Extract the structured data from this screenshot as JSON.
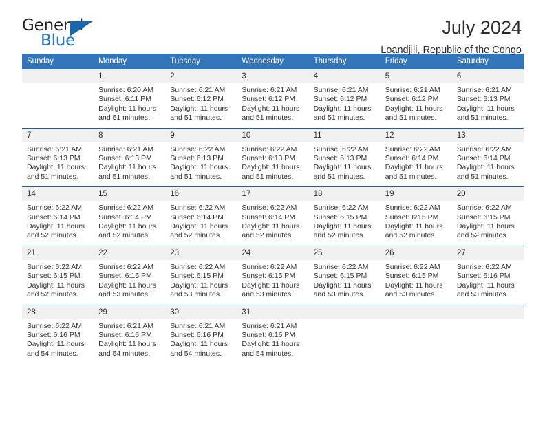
{
  "brand": {
    "name_top": "General",
    "name_bottom": "Blue",
    "accent_color": "#2176bd",
    "triangle_color": "#1866ab",
    "text_color": "#232323"
  },
  "header": {
    "title": "July 2024",
    "subtitle": "Loandjili, Republic of the Congo"
  },
  "theme": {
    "header_blue": "#3275b9",
    "row_divider": "#1f5f9e",
    "daynum_band": "#f0f0f0"
  },
  "calendar": {
    "weekdays": [
      "Sunday",
      "Monday",
      "Tuesday",
      "Wednesday",
      "Thursday",
      "Friday",
      "Saturday"
    ],
    "weeks": [
      [
        {
          "day": "",
          "sunrise": "",
          "sunset": "",
          "daylight_line1": "",
          "daylight_line2": ""
        },
        {
          "day": "1",
          "sunrise": "Sunrise: 6:20 AM",
          "sunset": "Sunset: 6:11 PM",
          "daylight_line1": "Daylight: 11 hours",
          "daylight_line2": "and 51 minutes."
        },
        {
          "day": "2",
          "sunrise": "Sunrise: 6:21 AM",
          "sunset": "Sunset: 6:12 PM",
          "daylight_line1": "Daylight: 11 hours",
          "daylight_line2": "and 51 minutes."
        },
        {
          "day": "3",
          "sunrise": "Sunrise: 6:21 AM",
          "sunset": "Sunset: 6:12 PM",
          "daylight_line1": "Daylight: 11 hours",
          "daylight_line2": "and 51 minutes."
        },
        {
          "day": "4",
          "sunrise": "Sunrise: 6:21 AM",
          "sunset": "Sunset: 6:12 PM",
          "daylight_line1": "Daylight: 11 hours",
          "daylight_line2": "and 51 minutes."
        },
        {
          "day": "5",
          "sunrise": "Sunrise: 6:21 AM",
          "sunset": "Sunset: 6:12 PM",
          "daylight_line1": "Daylight: 11 hours",
          "daylight_line2": "and 51 minutes."
        },
        {
          "day": "6",
          "sunrise": "Sunrise: 6:21 AM",
          "sunset": "Sunset: 6:13 PM",
          "daylight_line1": "Daylight: 11 hours",
          "daylight_line2": "and 51 minutes."
        }
      ],
      [
        {
          "day": "7",
          "sunrise": "Sunrise: 6:21 AM",
          "sunset": "Sunset: 6:13 PM",
          "daylight_line1": "Daylight: 11 hours",
          "daylight_line2": "and 51 minutes."
        },
        {
          "day": "8",
          "sunrise": "Sunrise: 6:21 AM",
          "sunset": "Sunset: 6:13 PM",
          "daylight_line1": "Daylight: 11 hours",
          "daylight_line2": "and 51 minutes."
        },
        {
          "day": "9",
          "sunrise": "Sunrise: 6:22 AM",
          "sunset": "Sunset: 6:13 PM",
          "daylight_line1": "Daylight: 11 hours",
          "daylight_line2": "and 51 minutes."
        },
        {
          "day": "10",
          "sunrise": "Sunrise: 6:22 AM",
          "sunset": "Sunset: 6:13 PM",
          "daylight_line1": "Daylight: 11 hours",
          "daylight_line2": "and 51 minutes."
        },
        {
          "day": "11",
          "sunrise": "Sunrise: 6:22 AM",
          "sunset": "Sunset: 6:13 PM",
          "daylight_line1": "Daylight: 11 hours",
          "daylight_line2": "and 51 minutes."
        },
        {
          "day": "12",
          "sunrise": "Sunrise: 6:22 AM",
          "sunset": "Sunset: 6:14 PM",
          "daylight_line1": "Daylight: 11 hours",
          "daylight_line2": "and 51 minutes."
        },
        {
          "day": "13",
          "sunrise": "Sunrise: 6:22 AM",
          "sunset": "Sunset: 6:14 PM",
          "daylight_line1": "Daylight: 11 hours",
          "daylight_line2": "and 51 minutes."
        }
      ],
      [
        {
          "day": "14",
          "sunrise": "Sunrise: 6:22 AM",
          "sunset": "Sunset: 6:14 PM",
          "daylight_line1": "Daylight: 11 hours",
          "daylight_line2": "and 52 minutes."
        },
        {
          "day": "15",
          "sunrise": "Sunrise: 6:22 AM",
          "sunset": "Sunset: 6:14 PM",
          "daylight_line1": "Daylight: 11 hours",
          "daylight_line2": "and 52 minutes."
        },
        {
          "day": "16",
          "sunrise": "Sunrise: 6:22 AM",
          "sunset": "Sunset: 6:14 PM",
          "daylight_line1": "Daylight: 11 hours",
          "daylight_line2": "and 52 minutes."
        },
        {
          "day": "17",
          "sunrise": "Sunrise: 6:22 AM",
          "sunset": "Sunset: 6:14 PM",
          "daylight_line1": "Daylight: 11 hours",
          "daylight_line2": "and 52 minutes."
        },
        {
          "day": "18",
          "sunrise": "Sunrise: 6:22 AM",
          "sunset": "Sunset: 6:15 PM",
          "daylight_line1": "Daylight: 11 hours",
          "daylight_line2": "and 52 minutes."
        },
        {
          "day": "19",
          "sunrise": "Sunrise: 6:22 AM",
          "sunset": "Sunset: 6:15 PM",
          "daylight_line1": "Daylight: 11 hours",
          "daylight_line2": "and 52 minutes."
        },
        {
          "day": "20",
          "sunrise": "Sunrise: 6:22 AM",
          "sunset": "Sunset: 6:15 PM",
          "daylight_line1": "Daylight: 11 hours",
          "daylight_line2": "and 52 minutes."
        }
      ],
      [
        {
          "day": "21",
          "sunrise": "Sunrise: 6:22 AM",
          "sunset": "Sunset: 6:15 PM",
          "daylight_line1": "Daylight: 11 hours",
          "daylight_line2": "and 52 minutes."
        },
        {
          "day": "22",
          "sunrise": "Sunrise: 6:22 AM",
          "sunset": "Sunset: 6:15 PM",
          "daylight_line1": "Daylight: 11 hours",
          "daylight_line2": "and 53 minutes."
        },
        {
          "day": "23",
          "sunrise": "Sunrise: 6:22 AM",
          "sunset": "Sunset: 6:15 PM",
          "daylight_line1": "Daylight: 11 hours",
          "daylight_line2": "and 53 minutes."
        },
        {
          "day": "24",
          "sunrise": "Sunrise: 6:22 AM",
          "sunset": "Sunset: 6:15 PM",
          "daylight_line1": "Daylight: 11 hours",
          "daylight_line2": "and 53 minutes."
        },
        {
          "day": "25",
          "sunrise": "Sunrise: 6:22 AM",
          "sunset": "Sunset: 6:15 PM",
          "daylight_line1": "Daylight: 11 hours",
          "daylight_line2": "and 53 minutes."
        },
        {
          "day": "26",
          "sunrise": "Sunrise: 6:22 AM",
          "sunset": "Sunset: 6:15 PM",
          "daylight_line1": "Daylight: 11 hours",
          "daylight_line2": "and 53 minutes."
        },
        {
          "day": "27",
          "sunrise": "Sunrise: 6:22 AM",
          "sunset": "Sunset: 6:16 PM",
          "daylight_line1": "Daylight: 11 hours",
          "daylight_line2": "and 53 minutes."
        }
      ],
      [
        {
          "day": "28",
          "sunrise": "Sunrise: 6:22 AM",
          "sunset": "Sunset: 6:16 PM",
          "daylight_line1": "Daylight: 11 hours",
          "daylight_line2": "and 54 minutes."
        },
        {
          "day": "29",
          "sunrise": "Sunrise: 6:21 AM",
          "sunset": "Sunset: 6:16 PM",
          "daylight_line1": "Daylight: 11 hours",
          "daylight_line2": "and 54 minutes."
        },
        {
          "day": "30",
          "sunrise": "Sunrise: 6:21 AM",
          "sunset": "Sunset: 6:16 PM",
          "daylight_line1": "Daylight: 11 hours",
          "daylight_line2": "and 54 minutes."
        },
        {
          "day": "31",
          "sunrise": "Sunrise: 6:21 AM",
          "sunset": "Sunset: 6:16 PM",
          "daylight_line1": "Daylight: 11 hours",
          "daylight_line2": "and 54 minutes."
        },
        {
          "day": "",
          "sunrise": "",
          "sunset": "",
          "daylight_line1": "",
          "daylight_line2": ""
        },
        {
          "day": "",
          "sunrise": "",
          "sunset": "",
          "daylight_line1": "",
          "daylight_line2": ""
        },
        {
          "day": "",
          "sunrise": "",
          "sunset": "",
          "daylight_line1": "",
          "daylight_line2": ""
        }
      ]
    ]
  }
}
